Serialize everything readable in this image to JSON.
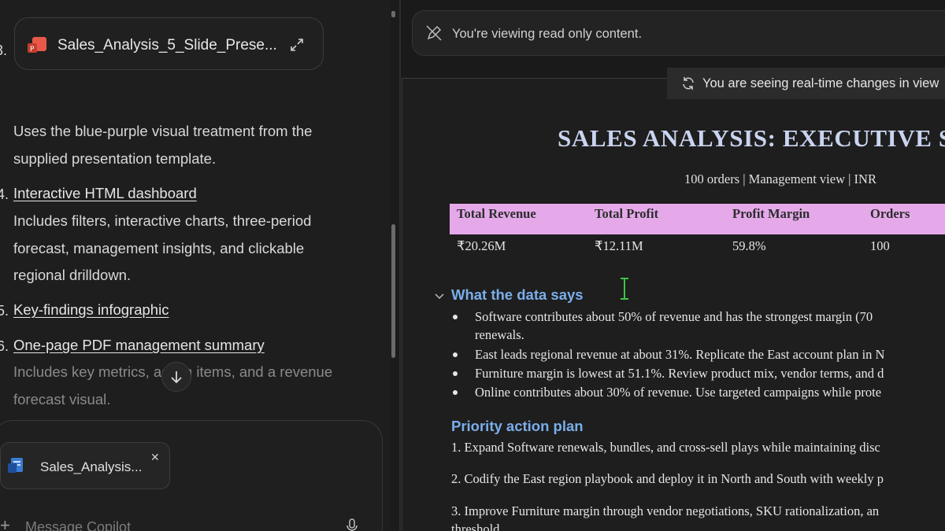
{
  "chat": {
    "attachment": {
      "index": "3.",
      "name": "Sales_Analysis_5_Slide_Prese..."
    },
    "intro_lines": [
      "Uses the blue-purple visual treatment from the",
      "supplied presentation template."
    ],
    "items": [
      {
        "num": "4.",
        "title": "Interactive HTML dashboard",
        "desc": [
          "Includes filters, interactive charts, three-period",
          "forecast, management insights, and clickable",
          "regional drilldown."
        ]
      },
      {
        "num": "5.",
        "title": "Key-findings infographic",
        "desc": []
      },
      {
        "num": "6.",
        "title": "One-page PDF management summary",
        "desc_faded": [
          "Includes key metrics, action items, and a revenue",
          "forecast visual."
        ]
      }
    ],
    "file_chip": {
      "name": "Sales_Analysis...",
      "close": "✕"
    },
    "composer": {
      "plus": "+",
      "placeholder": "Message Copilot"
    }
  },
  "viewer": {
    "readonly_text": "You're viewing read only content.",
    "realtime_text": "You are seeing real-time changes in view",
    "doc": {
      "title": "SALES ANALYSIS: EXECUTIVE SUMMARY",
      "subtitle": "100 orders | Management view | INR",
      "kpi": {
        "headers": [
          "Total Revenue",
          "Total Profit",
          "Profit Margin",
          "Orders"
        ],
        "values": [
          "₹20.26M",
          "₹12.11M",
          "59.8%",
          "100"
        ]
      },
      "section1": {
        "heading": "What the data says",
        "bullets": [
          "Software contributes about 50% of revenue and has the strongest margin (70",
          "renewals.",
          "East leads regional revenue at about 31%. Replicate the East account plan in N",
          "Furniture margin is lowest at 51.1%. Review product mix, vendor terms, and d",
          "Online contributes about 30% of revenue. Use targeted campaigns while prote"
        ]
      },
      "section2": {
        "heading": "Priority action plan",
        "steps": [
          "1. Expand Software renewals, bundles, and cross-sell plays while maintaining disc",
          "2. Codify the East region playbook and deploy it in North and South with weekly p",
          "3. Improve Furniture margin through vendor negotiations, SKU rationalization, an",
          "threshold."
        ]
      }
    }
  },
  "colors": {
    "kpi_header_bg": "#e5a9ea",
    "section_heading": "#7aaeea",
    "title": "#c9d4f0"
  }
}
